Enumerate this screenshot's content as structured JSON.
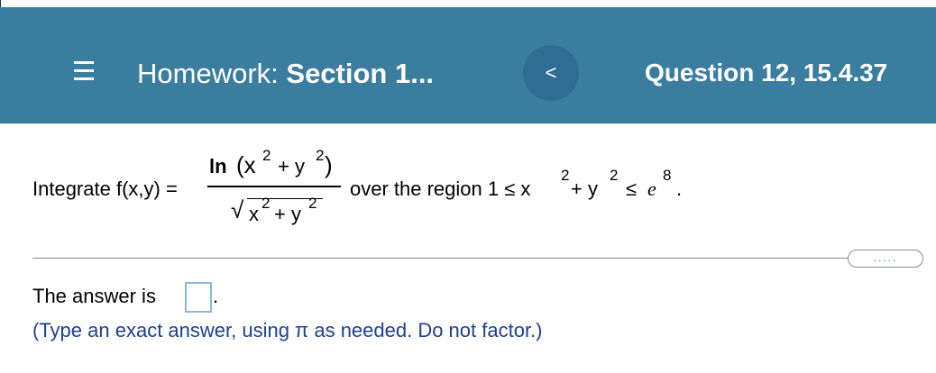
{
  "header": {
    "menu_icon": "hamburger-menu-icon",
    "homework_prefix": "Homework:",
    "section": "Section 1...",
    "prev_icon": "chevron-left-icon",
    "prev_glyph": "<",
    "question": "Question 12, 15.4.37",
    "colors": {
      "bar": "#3b7d9f",
      "button": "#2f6d92"
    }
  },
  "problem": {
    "lead": "Integrate f(x,y) =",
    "numerator": {
      "ln": "ln",
      "open": "(x",
      "exp1": "2",
      "plus": "+ y",
      "exp2": "2",
      "close": ")"
    },
    "denominator": {
      "radical": "√",
      "base": "x",
      "exp1": "2",
      "plus": "+ y",
      "exp2": "2"
    },
    "region_text": "over the region 1 ≤ x",
    "region_exp1": "2",
    "region_plus": "+ y",
    "region_exp2": "2",
    "region_le": "≤",
    "e": "e",
    "e_exp": "8",
    "period": "."
  },
  "more_glyph": ".....",
  "answer": {
    "label": "The answer is",
    "value": "",
    "period": ".",
    "hint": "(Type an exact answer, using π as needed. Do not factor.)"
  }
}
